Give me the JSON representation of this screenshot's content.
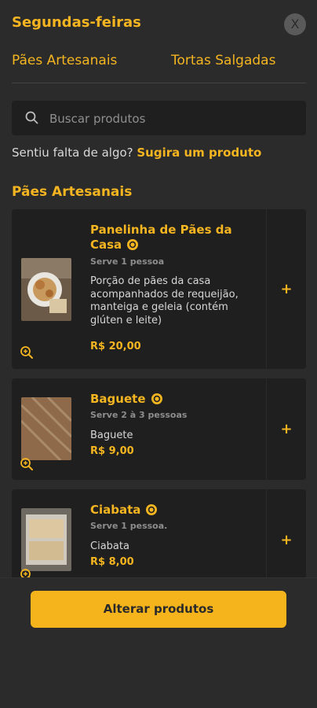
{
  "header": {
    "title": "Segundas-feiras",
    "close_label": "X"
  },
  "tabs": [
    {
      "label": "Pães Artesanais"
    },
    {
      "label": "Tortas Salgadas"
    }
  ],
  "search": {
    "placeholder": "Buscar produtos",
    "value": ""
  },
  "suggest": {
    "text": "Sentiu falta de algo? ",
    "link": "Sugira um produto"
  },
  "section": {
    "title": "Pães Artesanais"
  },
  "products": [
    {
      "name": "Panelinha de Pães da Casa",
      "serves": "Serve 1 pessoa",
      "description": "Porção de pães da casa acompanhados de requeijão, manteiga e geleia (contém glúten e leite)",
      "price": "R$ 20,00",
      "add": "+"
    },
    {
      "name": "Baguete",
      "serves": "Serve 2 à 3 pessoas",
      "description": "Baguete",
      "price": "R$ 9,00",
      "add": "+"
    },
    {
      "name": "Ciabata",
      "serves": "Serve 1 pessoa.",
      "description": "Ciabata",
      "price": "R$ 8,00",
      "add": "+"
    }
  ],
  "footer": {
    "cta_label": "Alterar produtos"
  },
  "colors": {
    "accent": "#f5b521",
    "background": "#2b2b2b",
    "card": "#1f1f1f"
  }
}
